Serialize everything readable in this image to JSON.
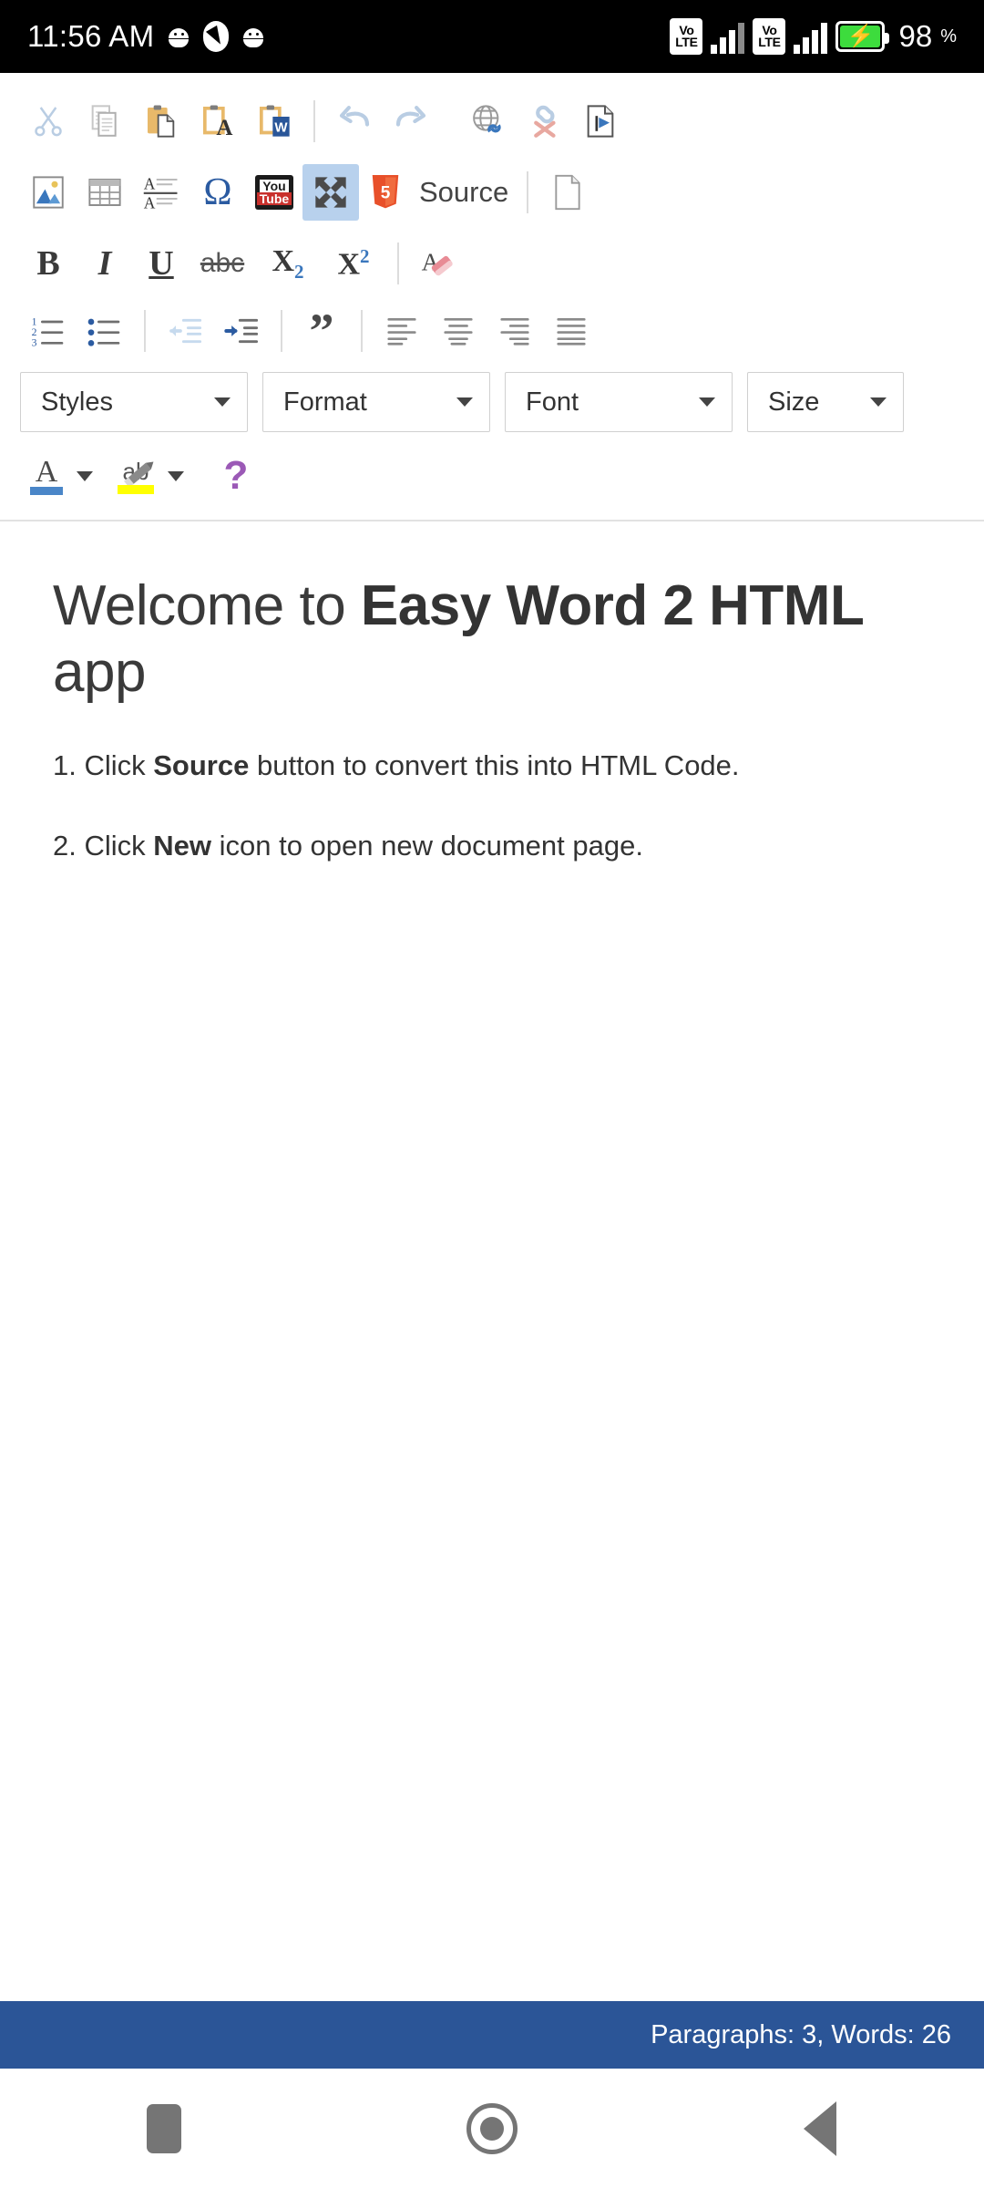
{
  "status_bar": {
    "clock": "11:56 AM",
    "icons_left": [
      "android-icon",
      "navigation-compass-icon",
      "android-icon"
    ],
    "network": [
      {
        "label_top": "Vo",
        "label_bottom": "LTE"
      },
      {
        "label_top": "Vo",
        "label_bottom": "LTE"
      }
    ],
    "battery_percent": "98",
    "battery_percent_symbol": "%",
    "battery_charging": true,
    "colors": {
      "background": "#000000",
      "battery_fill": "#3ddc3d"
    }
  },
  "toolbar": {
    "row1": [
      {
        "name": "cut-icon",
        "label": "Cut"
      },
      {
        "name": "copy-icon",
        "label": "Copy"
      },
      {
        "name": "paste-icon",
        "label": "Paste"
      },
      {
        "name": "paste-as-plain-text-icon",
        "label": "Paste as plain text"
      },
      {
        "name": "paste-from-word-icon",
        "label": "Paste from Word"
      },
      {
        "name": "undo-icon",
        "label": "Undo"
      },
      {
        "name": "redo-icon",
        "label": "Redo"
      },
      {
        "name": "link-icon",
        "label": "Link"
      },
      {
        "name": "unlink-icon",
        "label": "Unlink"
      },
      {
        "name": "anchor-icon",
        "label": "Anchor"
      }
    ],
    "row2": [
      {
        "name": "image-icon",
        "label": "Image"
      },
      {
        "name": "table-icon",
        "label": "Table"
      },
      {
        "name": "page-break-icon",
        "label": "Page Break"
      },
      {
        "name": "special-character-icon",
        "label": "Special Character",
        "glyph": "Ω"
      },
      {
        "name": "youtube-icon",
        "label": "YouTube",
        "text_top": "You",
        "text_bottom": "Tube"
      },
      {
        "name": "maximize-icon",
        "label": "Maximize",
        "active": true
      },
      {
        "name": "html5-source-icon",
        "label": "Source",
        "badge": "5"
      }
    ],
    "source_button_label": "Source",
    "new_document_label": "New Document",
    "row3": [
      {
        "name": "bold-icon",
        "label": "B"
      },
      {
        "name": "italic-icon",
        "label": "I"
      },
      {
        "name": "underline-icon",
        "label": "U"
      },
      {
        "name": "strikethrough-icon",
        "label": "abc"
      },
      {
        "name": "subscript-icon",
        "label": "X",
        "sub": "2"
      },
      {
        "name": "superscript-icon",
        "label": "X",
        "sup": "2"
      },
      {
        "name": "remove-format-icon",
        "label": "Remove Format"
      }
    ],
    "row4": [
      {
        "name": "numbered-list-icon",
        "label": "Insert/Remove Numbered List",
        "digits": [
          "1",
          "2",
          "3"
        ]
      },
      {
        "name": "bulleted-list-icon",
        "label": "Insert/Remove Bulleted List"
      },
      {
        "name": "outdent-icon",
        "label": "Decrease Indent"
      },
      {
        "name": "indent-icon",
        "label": "Increase Indent"
      },
      {
        "name": "blockquote-icon",
        "label": "Block Quote",
        "glyph": "”"
      },
      {
        "name": "align-left-icon",
        "label": "Align Left"
      },
      {
        "name": "align-center-icon",
        "label": "Center"
      },
      {
        "name": "align-right-icon",
        "label": "Align Right"
      },
      {
        "name": "justify-icon",
        "label": "Justify"
      }
    ],
    "selects": [
      {
        "name": "styles-select",
        "label": "Styles"
      },
      {
        "name": "format-select",
        "label": "Format"
      },
      {
        "name": "font-select",
        "label": "Font"
      },
      {
        "name": "size-select",
        "label": "Size"
      }
    ],
    "row6": [
      {
        "name": "text-color-icon",
        "label": "Text Color",
        "glyph": "A",
        "swatch": "#4a86c8"
      },
      {
        "name": "background-color-icon",
        "label": "Background Color",
        "glyph": "ab",
        "swatch": "#ffff00"
      },
      {
        "name": "about-help-icon",
        "label": "About CKEditor",
        "glyph": "?",
        "color": "#9b59b6"
      }
    ]
  },
  "document": {
    "heading": {
      "part1": "Welcome to ",
      "bold": "Easy Word 2 HTML",
      "part2": " app"
    },
    "paragraphs": [
      {
        "prefix": "1. Click ",
        "bold": "Source",
        "suffix": " button to convert this into HTML Code."
      },
      {
        "prefix": "2. Click ",
        "bold": "New",
        "suffix": " icon to open new document page."
      }
    ]
  },
  "editor_status": {
    "text": "Paragraphs: 3, Words: 26",
    "background": "#2b5597"
  },
  "nav_bar": {
    "recents_label": "Recents",
    "home_label": "Home",
    "back_label": "Back"
  }
}
